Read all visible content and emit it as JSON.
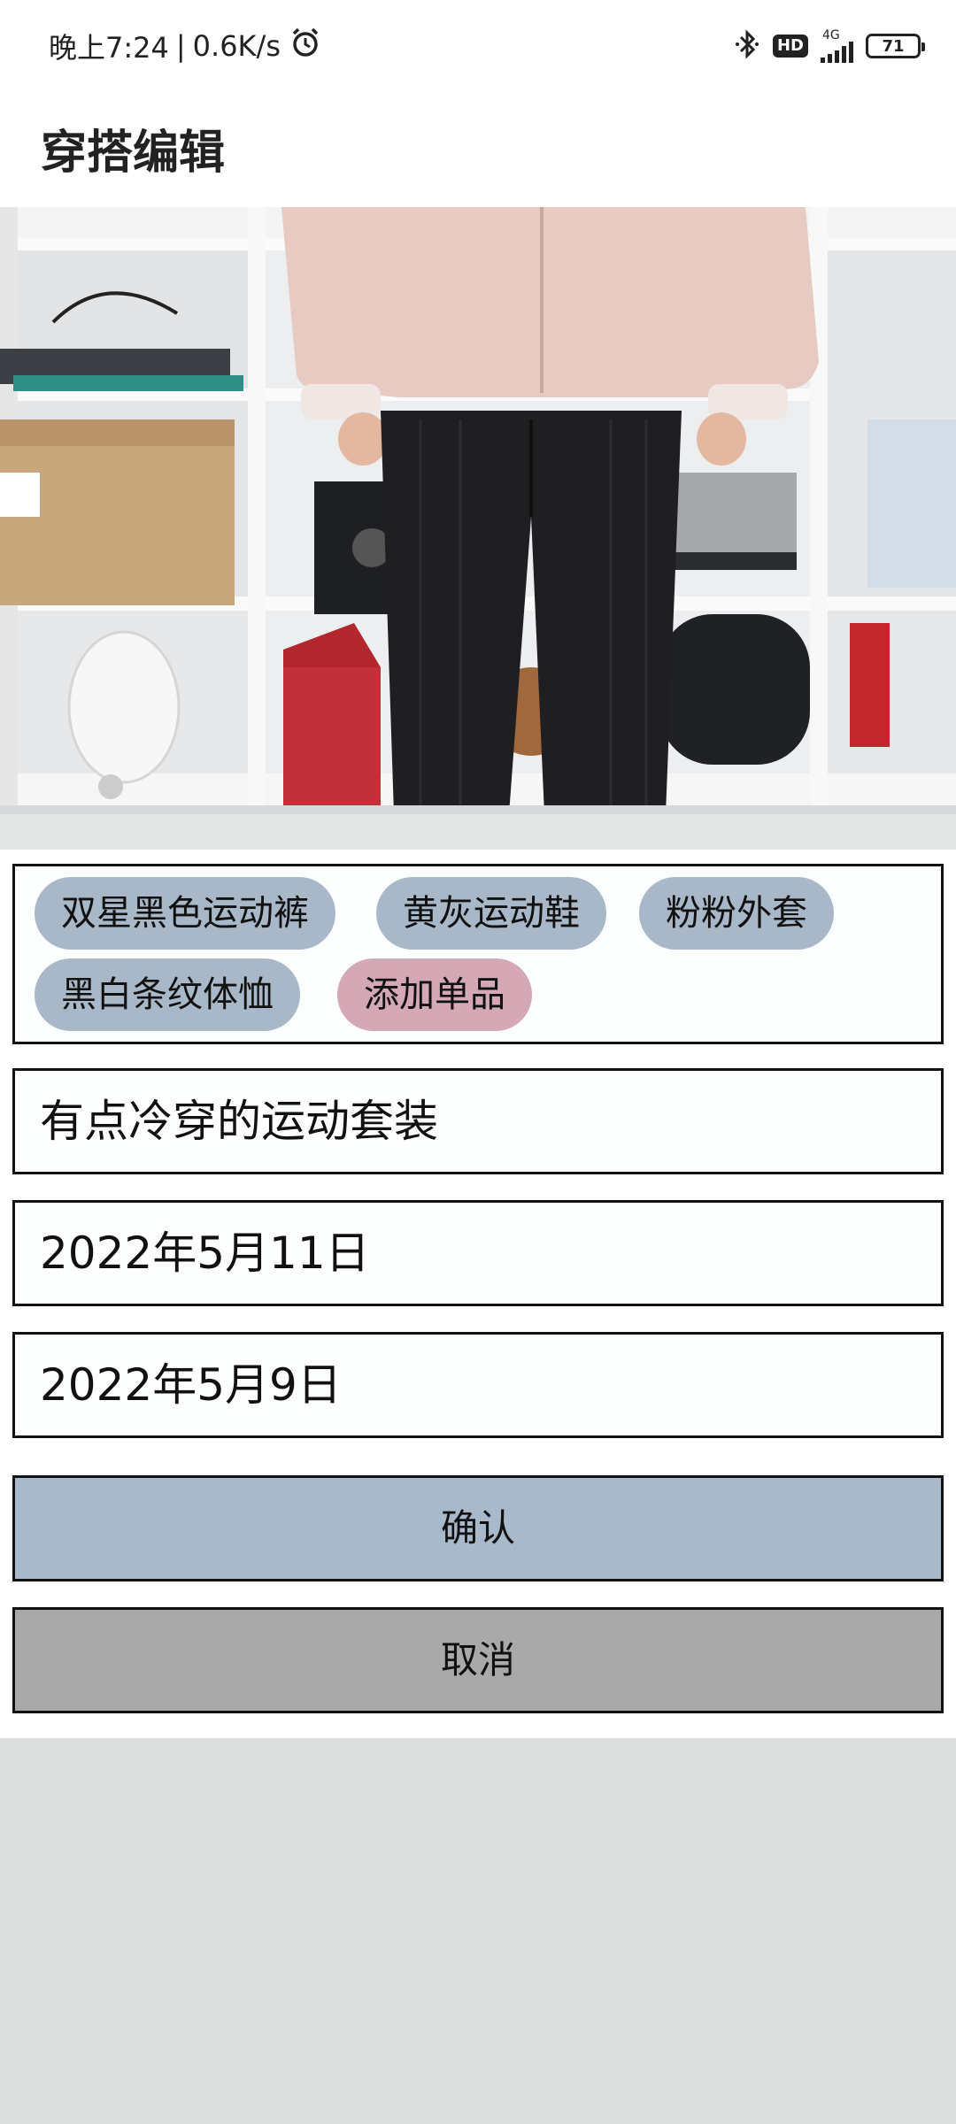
{
  "status_bar": {
    "time": "晚上7:24",
    "separator": "|",
    "speed": "0.6K/s",
    "hd": "HD",
    "network": "4G",
    "battery": "71",
    "icons": [
      "alarm-icon",
      "bluetooth-icon",
      "hd-badge",
      "signal-icon",
      "battery-icon"
    ]
  },
  "header": {
    "title": "穿搭编辑"
  },
  "photo": {
    "subject": "outfit-photo"
  },
  "tags": {
    "items": [
      "双星黑色运动裤",
      "黄灰运动鞋",
      "粉粉外套",
      "黑白条纹体恤"
    ],
    "add_label": "添加单品"
  },
  "form": {
    "description": "有点冷穿的运动套装",
    "date_1": "2022年5月11日",
    "date_2": "2022年5月9日"
  },
  "buttons": {
    "confirm": "确认",
    "cancel": "取消"
  },
  "colors": {
    "chip_item": "#a9b8c8",
    "chip_add": "#d4a8b5",
    "confirm_bg": "#a8b9cb",
    "cancel_bg": "#a9a9a9",
    "page_bg": "#dcdede"
  }
}
